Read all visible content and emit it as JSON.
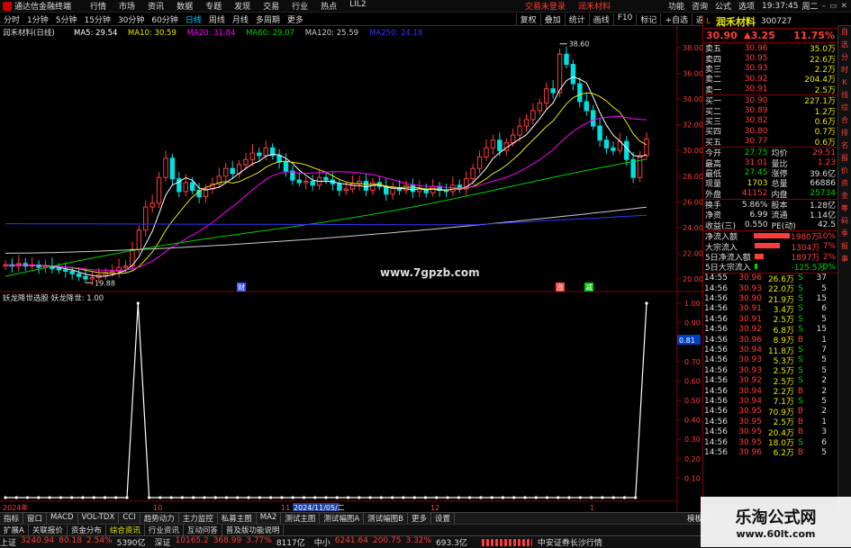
{
  "titlebar": {
    "app_name": "通达信金融终端",
    "menu": [
      "行情",
      "市场",
      "资讯",
      "数据",
      "专题",
      "发现",
      "交易",
      "行业",
      "热点",
      "LIL2"
    ],
    "center_links": [
      "交易未登录",
      "润禾材料"
    ],
    "right_menu": [
      "功能",
      "咨询",
      "公式",
      "选项"
    ],
    "time": "19:37:45",
    "weekday": "周二"
  },
  "toolbar": {
    "periods": [
      "分时",
      "1分钟",
      "5分钟",
      "15分钟",
      "30分钟",
      "60分钟",
      "日线",
      "周线",
      "月线",
      "多周期",
      "更多"
    ],
    "active_period": "日线",
    "right_buttons": [
      "复权",
      "叠加",
      "统计",
      "画线",
      "F10",
      "标记",
      "+自选",
      "返回"
    ]
  },
  "chart": {
    "header_label": "润禾材料(日线)",
    "ma_labels": [
      {
        "text": "MA5: 29.54",
        "color": "#ffffff"
      },
      {
        "text": "MA10: 30.59",
        "color": "#e8e800"
      },
      {
        "text": "MA20: 31.84",
        "color": "#ff00ff"
      },
      {
        "text": "MA60: 29.07",
        "color": "#00d000"
      },
      {
        "text": "MA120: 25.59",
        "color": "#cccccc"
      },
      {
        "text": "MA250: 24.18",
        "color": "#3333ff"
      }
    ],
    "price_axis": [
      "38.00",
      "36.00",
      "34.00",
      "32.00",
      "30.00",
      "28.00",
      "26.00",
      "24.00",
      "22.00",
      "20.00"
    ],
    "high_label": "38.60",
    "low_label": "19.88",
    "watermark": "www.7gpzb.com",
    "event_markers": [
      "财",
      "涨",
      "减"
    ],
    "indicator_header": "妖龙降世选股  妖龙降世: 1.00",
    "indicator_axis": [
      "1.00",
      "0.90",
      "0.80",
      "0.70",
      "0.60",
      "0.50",
      "0.40",
      "0.30",
      "0.20",
      "0.10"
    ],
    "indicator_current": "0.81",
    "date_axis": [
      "2024年",
      "10",
      "11",
      "2024/11/05/二",
      "12",
      "1"
    ]
  },
  "chart_data": {
    "type": "line",
    "title": "润禾材料(日线)",
    "series": [
      {
        "name": "妖龙降世",
        "values": [
          0,
          0,
          0,
          0,
          0,
          0,
          0,
          0,
          0,
          0,
          0,
          0,
          1,
          0,
          0,
          0,
          0,
          0,
          0,
          0,
          0,
          0,
          0,
          0,
          0,
          0,
          0,
          0,
          0,
          0,
          0,
          0,
          0,
          0,
          0,
          0,
          0,
          0,
          0,
          0,
          0,
          0,
          0,
          0,
          0,
          0,
          0,
          0,
          0,
          0,
          0,
          0,
          0,
          0,
          0,
          0,
          0,
          0,
          1
        ]
      }
    ],
    "ylim": [
      0,
      1
    ]
  },
  "tabs": [
    "指标",
    "窗口",
    "MACD",
    "VOL-TDX",
    "CCI",
    "趋势动力",
    "主力监控",
    "私募主图",
    "MA2",
    "测试主图",
    "测试幅图A",
    "测试幅图B",
    "更多",
    "设置"
  ],
  "tabs2": [
    "扩展A",
    "关联报价",
    "资金分布",
    "综合资讯",
    "行业资讯",
    "互动问答",
    "普及版功能说明"
  ],
  "tabs_right": [
    "模板"
  ],
  "stock": {
    "name": "润禾材料",
    "code": "300727",
    "price": "30.90",
    "change": "3.25",
    "change_pct": "11.75%",
    "asks": [
      {
        "label": "卖五",
        "price": "30.96",
        "vol": "35.0万"
      },
      {
        "label": "卖四",
        "price": "30.95",
        "vol": "22.6万"
      },
      {
        "label": "卖三",
        "price": "30.93",
        "vol": "2.2万"
      },
      {
        "label": "卖二",
        "price": "30.92",
        "vol": "204.4万"
      },
      {
        "label": "卖一",
        "price": "30.91",
        "vol": "2.5万"
      }
    ],
    "bids": [
      {
        "label": "买一",
        "price": "30.90",
        "vol": "227.1万"
      },
      {
        "label": "买二",
        "price": "30.89",
        "vol": "1.2万"
      },
      {
        "label": "买三",
        "price": "30.82",
        "vol": "0.6万"
      },
      {
        "label": "买四",
        "price": "30.80",
        "vol": "0.7万"
      },
      {
        "label": "买五",
        "price": "30.77",
        "vol": "0.6万"
      }
    ],
    "stats": [
      {
        "l1": "今开",
        "v1": "27.75",
        "c1": "g",
        "l2": "均价",
        "v2": "29.51",
        "c2": "r"
      },
      {
        "l1": "最高",
        "v1": "31.01",
        "c1": "r",
        "l2": "量比",
        "v2": "1.23",
        "c2": "r"
      },
      {
        "l1": "最低",
        "v1": "27.45",
        "c1": "g",
        "l2": "涨停",
        "v2": "39.6亿",
        "c2": "w"
      },
      {
        "l1": "现量",
        "v1": "1703",
        "c1": "y",
        "l2": "总量",
        "v2": "66886",
        "c2": "w"
      },
      {
        "l1": "外盘",
        "v1": "41152",
        "c1": "r",
        "l2": "内盘",
        "v2": "25734",
        "c2": "g"
      }
    ],
    "stats2": [
      {
        "l1": "换手",
        "v1": "5.86%",
        "l2": "股本",
        "v2": "1.28亿"
      },
      {
        "l1": "净资",
        "v1": "6.99",
        "l2": "流通",
        "v2": "1.14亿"
      },
      {
        "l1": "收益(三)",
        "v1": "0.550",
        "l2": "PE(动)",
        "v2": "42.5"
      }
    ],
    "flows": [
      {
        "label": "净流入额",
        "value": "1980万",
        "pct": "10%",
        "color": "#ff3b3b",
        "w": 40
      },
      {
        "label": "大宗流入",
        "value": "1304万",
        "pct": "7%",
        "color": "#ff3b3b",
        "w": 28
      },
      {
        "label": "5日净流入额",
        "value": "1897万",
        "pct": "2%",
        "color": "#ff3b3b",
        "w": 10
      },
      {
        "label": "5日大宗流入",
        "value": "-125.5万",
        "pct": "-0%",
        "color": "#00d000",
        "w": 3
      }
    ],
    "trades": [
      {
        "t": "14:55",
        "p": "30.96",
        "v": "26.6万",
        "s": "S",
        "n": "37",
        "c": "g"
      },
      {
        "t": "14:56",
        "p": "30.93",
        "v": "22.0万",
        "s": "S",
        "n": "5",
        "c": "g"
      },
      {
        "t": "14:56",
        "p": "30.90",
        "v": "21.9万",
        "s": "S",
        "n": "15",
        "c": "g"
      },
      {
        "t": "14:56",
        "p": "30.91",
        "v": "3.4万",
        "s": "S",
        "n": "6",
        "c": "g"
      },
      {
        "t": "14:56",
        "p": "30.91",
        "v": "2.5万",
        "s": "S",
        "n": "5",
        "c": "g"
      },
      {
        "t": "14:56",
        "p": "30.92",
        "v": "6.8万",
        "s": "S",
        "n": "15",
        "c": "g"
      },
      {
        "t": "14:56",
        "p": "30.96",
        "v": "8.9万",
        "s": "B",
        "n": "1",
        "c": "r"
      },
      {
        "t": "14:56",
        "p": "30.94",
        "v": "11.8万",
        "s": "S",
        "n": "7",
        "c": "g"
      },
      {
        "t": "14:56",
        "p": "30.93",
        "v": "5.3万",
        "s": "S",
        "n": "5",
        "c": "g"
      },
      {
        "t": "14:56",
        "p": "30.93",
        "v": "2.5万",
        "s": "S",
        "n": "5",
        "c": "g"
      },
      {
        "t": "14:56",
        "p": "30.92",
        "v": "2.5万",
        "s": "S",
        "n": "2",
        "c": "g"
      },
      {
        "t": "14:56",
        "p": "30.94",
        "v": "2.2万",
        "s": "B",
        "n": "2",
        "c": "r"
      },
      {
        "t": "14:56",
        "p": "30.94",
        "v": "7.1万",
        "s": "S",
        "n": "5",
        "c": "g"
      },
      {
        "t": "14:56",
        "p": "30.95",
        "v": "70.9万",
        "s": "B",
        "n": "2",
        "c": "r"
      },
      {
        "t": "14:56",
        "p": "30.95",
        "v": "2.5万",
        "s": "B",
        "n": "1",
        "c": "r"
      },
      {
        "t": "14:56",
        "p": "30.95",
        "v": "20.4万",
        "s": "B",
        "n": "3",
        "c": "r"
      },
      {
        "t": "14:56",
        "p": "30.95",
        "v": "18.0万",
        "s": "S",
        "n": "6",
        "c": "g"
      },
      {
        "t": "14:56",
        "p": "30.96",
        "v": "6.2万",
        "s": "B",
        "n": "5",
        "c": "r"
      }
    ]
  },
  "right_strip": [
    "自",
    "选",
    "分",
    "时",
    "K",
    "线",
    "综",
    "合",
    "排",
    "名",
    "报",
    "价",
    "资",
    "金",
    "筹",
    "码",
    "季",
    "报",
    "事"
  ],
  "status": {
    "indices": [
      {
        "name": "上证",
        "value": "3240.94",
        "chg": "80.18",
        "pct": "2.54%",
        "amt": "5390亿"
      },
      {
        "name": "深证",
        "value": "10165.2",
        "chg": "368.99",
        "pct": "3.77%",
        "amt": "8117亿"
      },
      {
        "name": "中小",
        "value": "6241.64",
        "chg": "200.75",
        "pct": "3.32%",
        "amt": "693.3亿"
      }
    ],
    "broker": "中安证券长沙行情"
  },
  "bottom_watermark": "乐淘公式网",
  "bottom_watermark2": "www.60lt.com"
}
